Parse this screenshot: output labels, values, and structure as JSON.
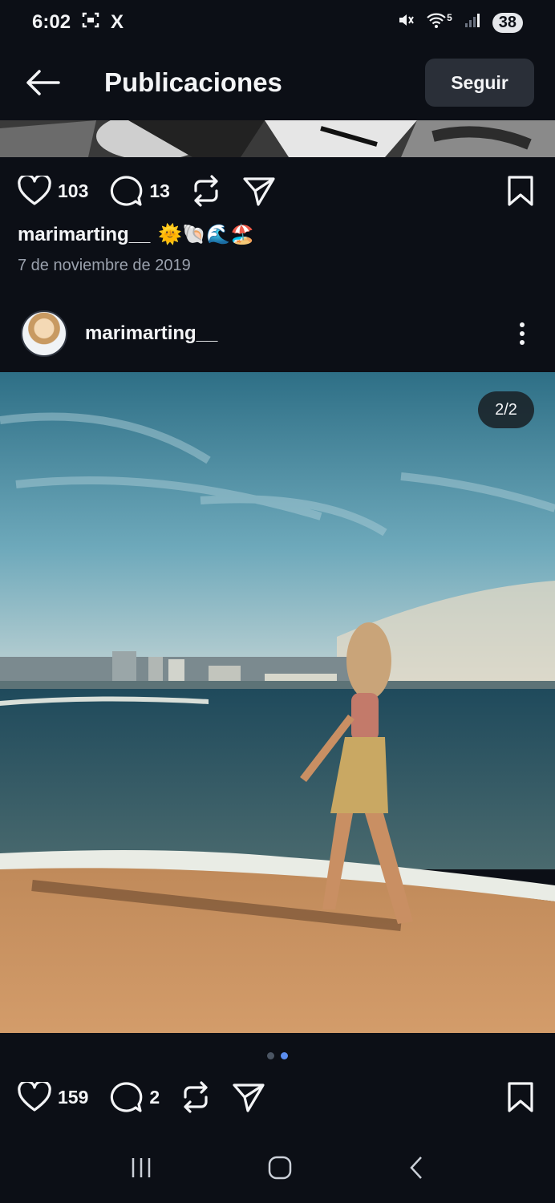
{
  "status_bar": {
    "time": "6:02",
    "x_label": "X",
    "battery": "38",
    "network_label": "5"
  },
  "header": {
    "title": "Publicaciones",
    "follow_label": "Seguir"
  },
  "previous_post": {
    "likes": "103",
    "comments": "13",
    "caption_user": "marimarting__",
    "caption_emojis": "🌞🐚🌊🏖️",
    "date": "7 de noviembre de 2019"
  },
  "current_post": {
    "username": "marimarting__",
    "image_counter": "2/2",
    "likes": "159",
    "comments": "2",
    "carousel_dots": 2,
    "active_dot": 1
  },
  "colors": {
    "background": "#0c0f16",
    "accent_dot": "#5b8def",
    "inactive_dot": "#4b5563"
  }
}
